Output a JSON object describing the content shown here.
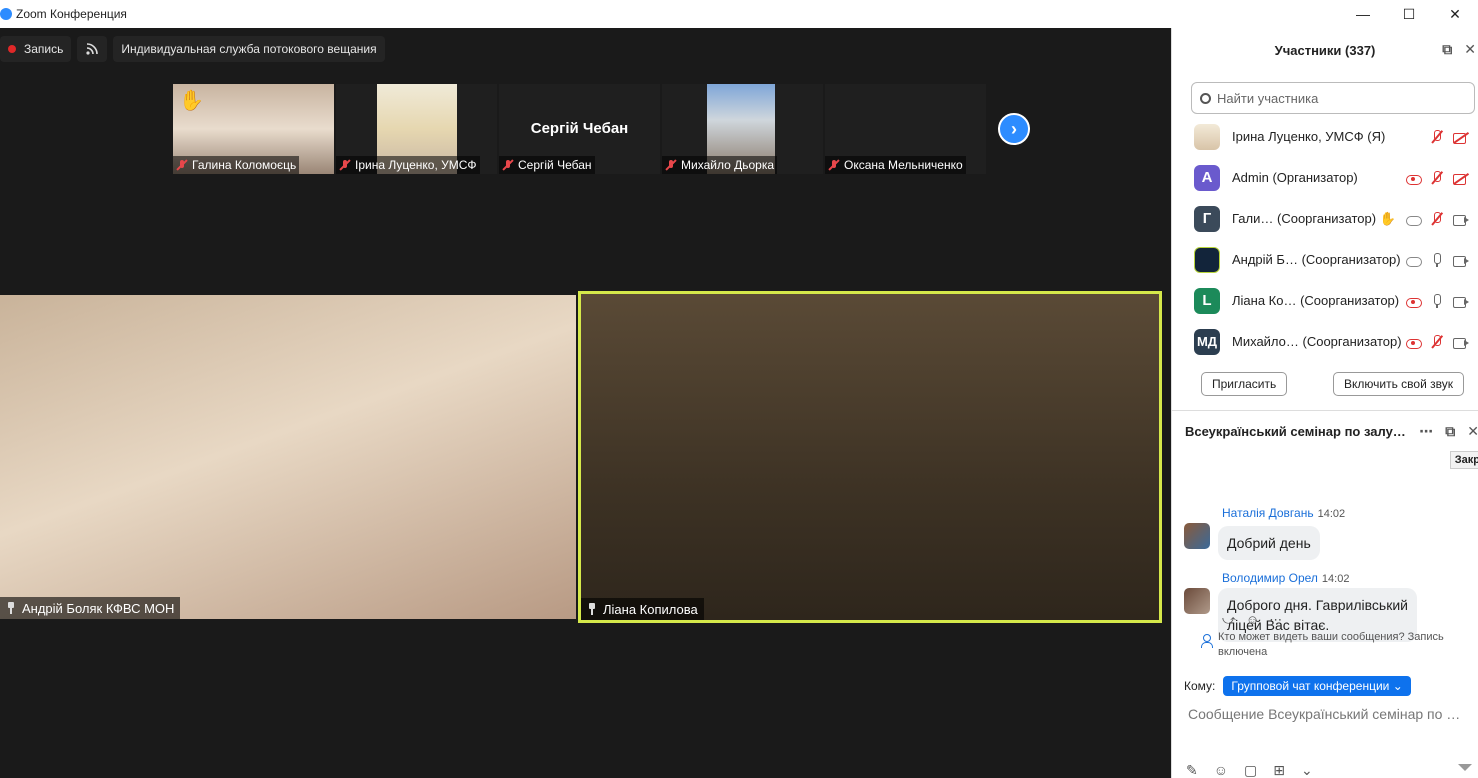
{
  "window": {
    "title": "Zoom Конференция",
    "controls": [
      "—",
      "☐",
      "✕"
    ]
  },
  "topbar": {
    "record_label": "Запись",
    "stream_label": "Индивидуальная служба потокового вещания"
  },
  "thumbnails": [
    {
      "name": "Галина Коломоєць",
      "hand": "✋"
    },
    {
      "name": "Ірина Луценко, УМСФ"
    },
    {
      "name": "Сергій Чебан",
      "center_name": "Сергій Чебан"
    },
    {
      "name": "Михайло Дьорка"
    },
    {
      "name": "Оксана Мельниченко"
    }
  ],
  "next_arrow": "›",
  "videos": [
    {
      "name": "Андрій Боляк КФВС МОН"
    },
    {
      "name": "Ліана Копилова"
    }
  ],
  "participants": {
    "title": "Участники (337)",
    "header_icons": [
      "⧉",
      "✕"
    ],
    "search_placeholder": "Найти участника",
    "rows": [
      {
        "initial": "",
        "name": "Ірина Луценко, УМСФ (Я)"
      },
      {
        "initial": "A",
        "name": "Admin (Организатор)",
        "color": "#6a5acd"
      },
      {
        "initial": "Г",
        "name": "Гали…  (Соорганизатор) ✋",
        "color": "#3b4a5a"
      },
      {
        "initial": "",
        "name": "Андрій Б…  (Соорганизатор)"
      },
      {
        "initial": "L",
        "name": "Ліана Ко…  (Соорганизатор)",
        "color": "#1c8a5a"
      },
      {
        "initial": "МД",
        "name": "Михайло…  (Соорганизатор)",
        "color": "#2c3e50"
      }
    ],
    "invite_label": "Пригласить",
    "unmute_label": "Включить свой звук"
  },
  "chat": {
    "title": "Всеукраїнський семінар по залу…",
    "header_icons": [
      "⋯",
      "⧉",
      "✕"
    ],
    "tooltip": "Закр",
    "messages": [
      {
        "sender": "Наталія Довгань",
        "time": "14:02",
        "text": "Добрий день"
      },
      {
        "sender": "Володимир Орел",
        "time": "14:02",
        "text_line1": "Доброго дня. Гаврилівський",
        "text_line2": "ліцей Вас вітає."
      }
    ],
    "actions": [
      "⤻",
      "☺",
      "⋯"
    ],
    "privacy_text": "Кто может видеть ваши сообщения? Запись включена",
    "to_label": "Кому:",
    "to_value": "Групповой чат конференции ⌄",
    "composer_placeholder": "Сообщение Всеукраїнський семінар по …",
    "toolbar_icons": [
      "✎",
      "☺",
      "▢",
      "⊞",
      "⌄"
    ]
  },
  "colors": {
    "accent": "#2d8cff",
    "active_speaker_border": "#d5e84a",
    "stage_bg": "#1a1a1a",
    "mute_red": "#e8474b"
  }
}
